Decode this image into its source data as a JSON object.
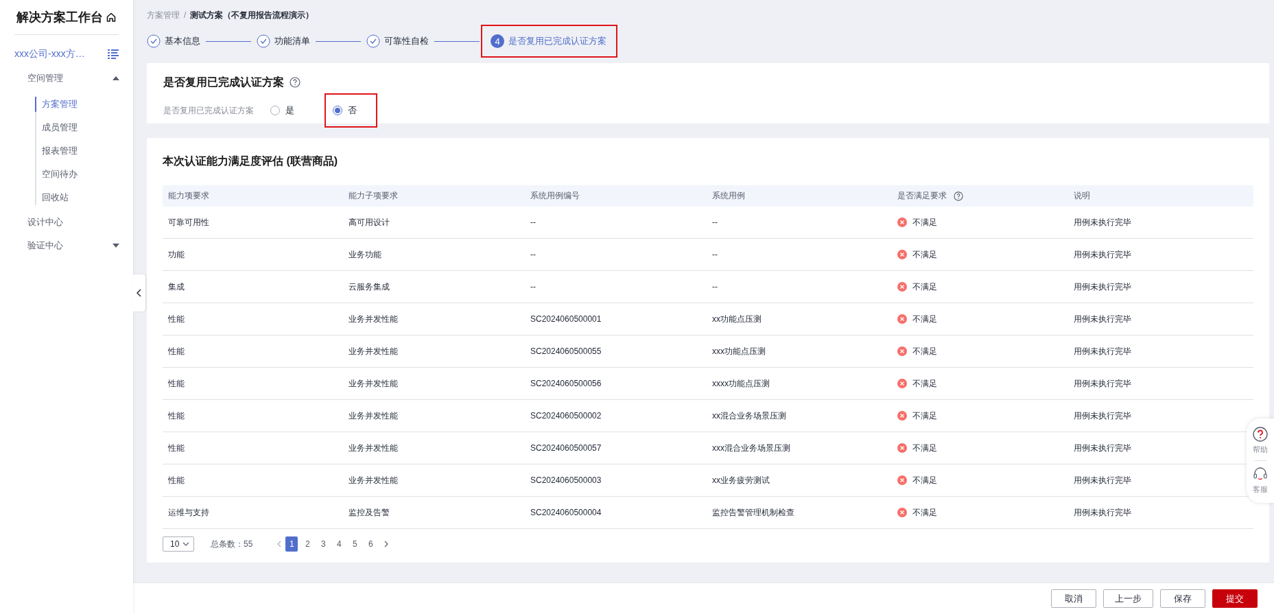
{
  "sidebar": {
    "title": "解决方案工作台",
    "project": "xxx公司-xxx方…",
    "items": [
      {
        "label": "空间管理",
        "kind": "group",
        "expanded": true,
        "children": [
          {
            "label": "方案管理",
            "selected": true
          },
          {
            "label": "成员管理",
            "selected": false
          },
          {
            "label": "报表管理",
            "selected": false
          },
          {
            "label": "空间待办",
            "selected": false
          },
          {
            "label": "回收站",
            "selected": false
          }
        ]
      },
      {
        "label": "设计中心",
        "kind": "link"
      },
      {
        "label": "验证中心",
        "kind": "group",
        "expanded": false
      }
    ]
  },
  "breadcrumb": [
    {
      "label": "方案管理",
      "current": false
    },
    {
      "label": "测试方案（不复用报告流程演示）",
      "current": true
    }
  ],
  "breadcrumb_separator": "/",
  "steps": [
    {
      "label": "基本信息",
      "completed": true,
      "highlighted": false
    },
    {
      "label": "功能清单",
      "completed": true,
      "highlighted": false
    },
    {
      "label": "可靠性自检",
      "completed": true,
      "highlighted": false
    },
    {
      "label": "是否复用已完成认证方案",
      "completed": false,
      "number": "4",
      "highlighted": true
    }
  ],
  "reuse_card": {
    "title": "是否复用已完成认证方案",
    "field_label": "是否复用已完成认证方案",
    "options": [
      {
        "label": "是",
        "selected": false,
        "highlighted": false
      },
      {
        "label": "否",
        "selected": true,
        "highlighted": true
      }
    ]
  },
  "assessment": {
    "title": "本次认证能力满足度评估 (联营商品)",
    "table": {
      "columns": [
        "能力项要求",
        "能力子项要求",
        "系统用例编号",
        "系统用例",
        "是否满足要求",
        "说明"
      ],
      "rows": [
        {
          "cells": [
            "可靠可用性",
            "高可用设计",
            "--",
            "--"
          ],
          "met": false,
          "status": "不满足",
          "note": "用例未执行完毕"
        },
        {
          "cells": [
            "功能",
            "业务功能",
            "--",
            "--"
          ],
          "met": false,
          "status": "不满足",
          "note": "用例未执行完毕"
        },
        {
          "cells": [
            "集成",
            "云服务集成",
            "--",
            "--"
          ],
          "met": false,
          "status": "不满足",
          "note": "用例未执行完毕"
        },
        {
          "cells": [
            "性能",
            "业务并发性能",
            "SC2024060500001",
            "xx功能点压测"
          ],
          "met": false,
          "status": "不满足",
          "note": "用例未执行完毕"
        },
        {
          "cells": [
            "性能",
            "业务并发性能",
            "SC2024060500055",
            "xxx功能点压测"
          ],
          "met": false,
          "status": "不满足",
          "note": "用例未执行完毕"
        },
        {
          "cells": [
            "性能",
            "业务并发性能",
            "SC2024060500056",
            "xxxx功能点压测"
          ],
          "met": false,
          "status": "不满足",
          "note": "用例未执行完毕"
        },
        {
          "cells": [
            "性能",
            "业务并发性能",
            "SC2024060500002",
            "xx混合业务场景压测"
          ],
          "met": false,
          "status": "不满足",
          "note": "用例未执行完毕"
        },
        {
          "cells": [
            "性能",
            "业务并发性能",
            "SC2024060500057",
            "xxx混合业务场景压测"
          ],
          "met": false,
          "status": "不满足",
          "note": "用例未执行完毕"
        },
        {
          "cells": [
            "性能",
            "业务并发性能",
            "SC2024060500003",
            "xx业务疲劳测试"
          ],
          "met": false,
          "status": "不满足",
          "note": "用例未执行完毕"
        },
        {
          "cells": [
            "运维与支持",
            "监控及告警",
            "SC2024060500004",
            "监控告警管理机制检查"
          ],
          "met": false,
          "status": "不满足",
          "note": "用例未执行完毕"
        }
      ]
    },
    "pagination": {
      "page_size": "10",
      "total": "总条数：55",
      "pages": [
        {
          "label": "1",
          "selected": true
        },
        {
          "label": "2",
          "selected": false
        },
        {
          "label": "3",
          "selected": false
        },
        {
          "label": "4",
          "selected": false
        },
        {
          "label": "5",
          "selected": false
        },
        {
          "label": "6",
          "selected": false
        }
      ]
    }
  },
  "float_tools": [
    "帮助",
    "客服"
  ],
  "footer_buttons": [
    {
      "label": "取消",
      "kind": "default"
    },
    {
      "label": "上一步",
      "kind": "default"
    },
    {
      "label": "保存",
      "kind": "default"
    },
    {
      "label": "提交",
      "kind": "primary"
    }
  ]
}
